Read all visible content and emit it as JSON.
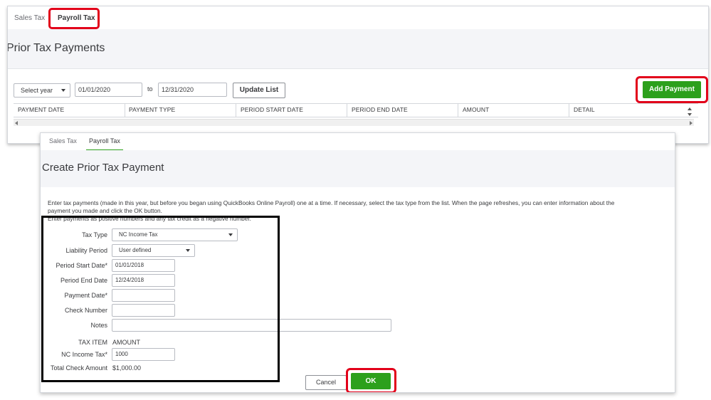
{
  "panel1": {
    "tabs": [
      {
        "label": "Sales Tax",
        "active": false
      },
      {
        "label": "Payroll Tax",
        "active": true
      }
    ],
    "title": "Prior Tax Payments",
    "filters": {
      "year_select": "Select year",
      "start_date": "01/01/2020",
      "to_label": "to",
      "end_date": "12/31/2020",
      "update_button": "Update List"
    },
    "add_payment_button": "Add Payment",
    "table": {
      "columns": [
        "PAYMENT DATE",
        "PAYMENT TYPE",
        "PERIOD START DATE",
        "PERIOD END DATE",
        "AMOUNT",
        "DETAIL"
      ]
    }
  },
  "panel2": {
    "tabs": [
      {
        "label": "Sales Tax",
        "active": false
      },
      {
        "label": "Payroll Tax",
        "active": true
      }
    ],
    "title": "Create Prior Tax Payment",
    "instructions": [
      "Enter tax payments (made in this year, but before you began using QuickBooks Online Payroll) one at a time. If necessary, select the tax type from the list. When the page refreshes, you can enter information about the",
      "payment you made and click the OK button.",
      "Enter payments as positive numbers and any tax credit as a negative number."
    ],
    "form": {
      "tax_type": {
        "label": "Tax Type",
        "value": "NC Income Tax"
      },
      "liability_period": {
        "label": "Liability Period",
        "value": "User defined"
      },
      "period_start": {
        "label": "Period Start Date*",
        "value": "01/01/2018"
      },
      "period_end": {
        "label": "Period End Date",
        "value": "12/24/2018"
      },
      "payment_date": {
        "label": "Payment Date*",
        "value": ""
      },
      "check_number": {
        "label": "Check Number",
        "value": ""
      },
      "notes": {
        "label": "Notes",
        "value": ""
      },
      "tax_item_header": "TAX ITEM",
      "amount_header": "AMOUNT",
      "nc_income_tax": {
        "label": "NC Income Tax*",
        "value": "1000"
      },
      "total_check_amount": {
        "label": "Total Check Amount",
        "value": "$1,000.00"
      }
    },
    "cancel_button": "Cancel",
    "ok_button": "OK"
  },
  "colors": {
    "accent_green": "#2ca01c",
    "highlight_red": "#e2001a",
    "annotation_black": "#000000"
  }
}
